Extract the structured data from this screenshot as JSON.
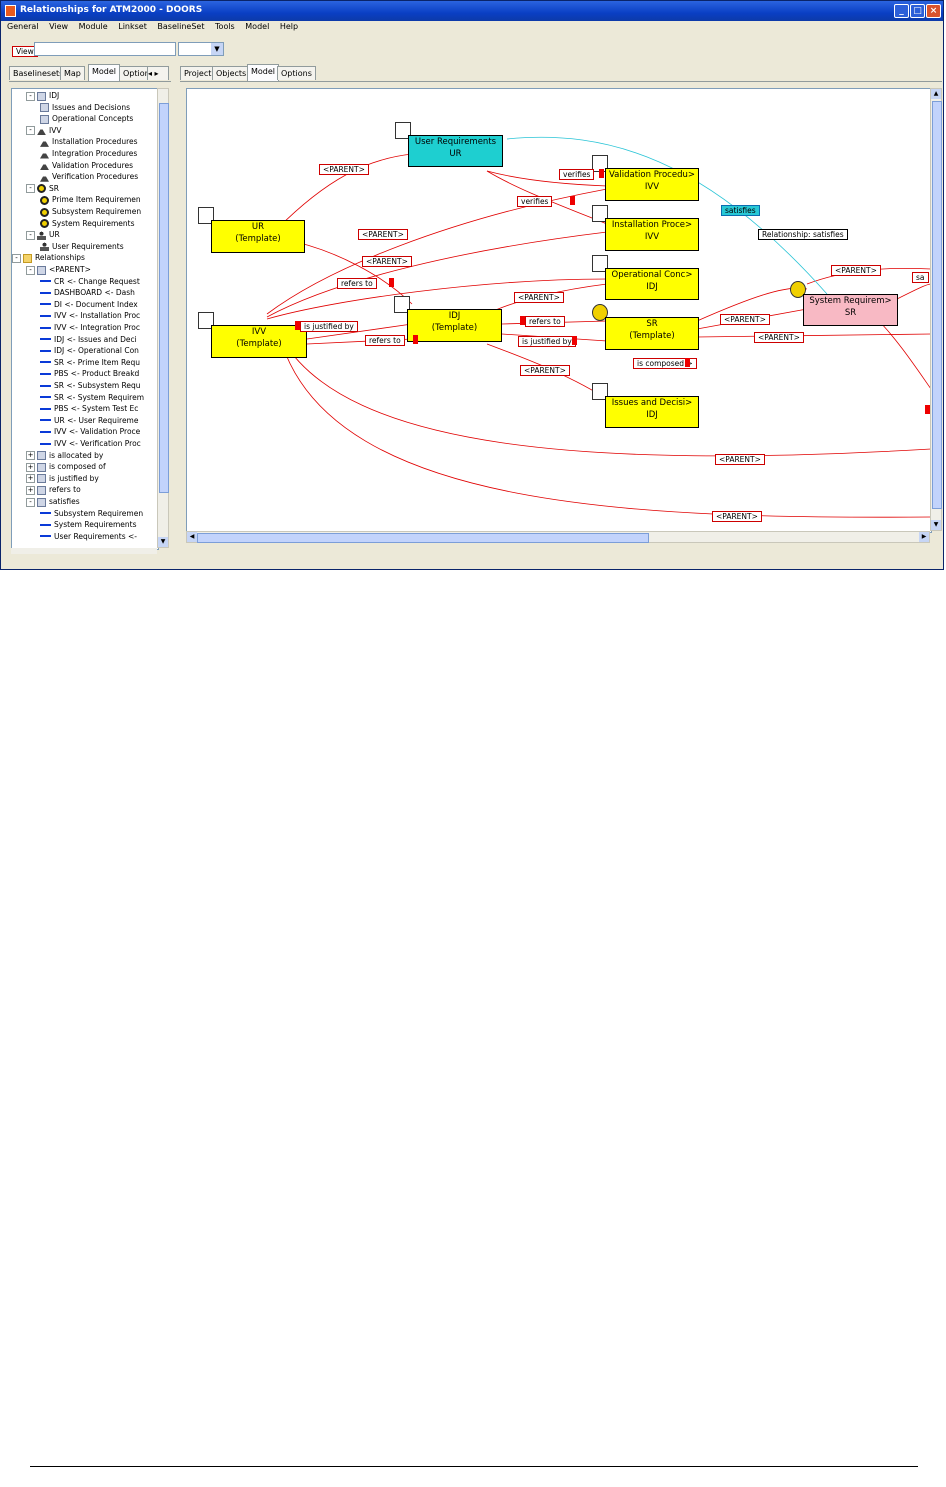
{
  "window": {
    "title": "Relationships for ATM2000 - DOORS"
  },
  "menu": [
    "General",
    "View",
    "Module",
    "Linkset",
    "BaselineSet",
    "Tools",
    "Model",
    "Help"
  ],
  "view_row": {
    "label": "View",
    "value": ""
  },
  "left_tabs": [
    "Baselinesets",
    "Map",
    "Model",
    "Option"
  ],
  "left_tab_selected": "Model",
  "tree": [
    {
      "indent": 0,
      "expander": "-",
      "icon": "mod",
      "label": "IDJ"
    },
    {
      "indent": 1,
      "icon": "mod",
      "label": "Issues and Decisions"
    },
    {
      "indent": 1,
      "icon": "mod",
      "label": "Operational Concepts"
    },
    {
      "indent": 0,
      "expander": "-",
      "icon": "flask",
      "label": "IVV"
    },
    {
      "indent": 1,
      "icon": "flask",
      "label": "Installation Procedures"
    },
    {
      "indent": 1,
      "icon": "flask",
      "label": "Integration Procedures"
    },
    {
      "indent": 1,
      "icon": "flask",
      "label": "Validation Procedures"
    },
    {
      "indent": 1,
      "icon": "flask",
      "label": "Verification Procedures"
    },
    {
      "indent": 0,
      "expander": "-",
      "icon": "gear",
      "label": "SR"
    },
    {
      "indent": 1,
      "icon": "gear",
      "label": "Prime Item Requiremen"
    },
    {
      "indent": 1,
      "icon": "gear",
      "label": "Subsystem Requiremen"
    },
    {
      "indent": 1,
      "icon": "gear",
      "label": "System Requirements"
    },
    {
      "indent": 0,
      "expander": "-",
      "icon": "person",
      "label": "UR"
    },
    {
      "indent": 1,
      "icon": "person",
      "label": "User Requirements"
    },
    {
      "indent": -1,
      "expander": "-",
      "icon": "folder",
      "label": "Relationships"
    },
    {
      "indent": 0,
      "expander": "-",
      "icon": "mod",
      "label": "<PARENT>"
    },
    {
      "indent": 1,
      "icon": "arrow",
      "label": "CR <- Change Request"
    },
    {
      "indent": 1,
      "icon": "arrow",
      "label": "DASHBOARD <- Dash"
    },
    {
      "indent": 1,
      "icon": "arrow",
      "label": "DI <- Document Index"
    },
    {
      "indent": 1,
      "icon": "arrow",
      "label": "IVV <- Installation Proc"
    },
    {
      "indent": 1,
      "icon": "arrow",
      "label": "IVV <- Integration Proc"
    },
    {
      "indent": 1,
      "icon": "arrow",
      "label": "IDJ <- Issues and Deci"
    },
    {
      "indent": 1,
      "icon": "arrow",
      "label": "IDJ <- Operational Con"
    },
    {
      "indent": 1,
      "icon": "arrow",
      "label": "SR <- Prime Item Requ"
    },
    {
      "indent": 1,
      "icon": "arrow",
      "label": "PBS <- Product Breakd"
    },
    {
      "indent": 1,
      "icon": "arrow",
      "label": "SR <- Subsystem Requ"
    },
    {
      "indent": 1,
      "icon": "arrow",
      "label": "SR <- System Requirem"
    },
    {
      "indent": 1,
      "icon": "arrow",
      "label": "PBS <- System Test Ec"
    },
    {
      "indent": 1,
      "icon": "arrow",
      "label": "UR <- User Requireme"
    },
    {
      "indent": 1,
      "icon": "arrow",
      "label": "IVV <- Validation Proce"
    },
    {
      "indent": 1,
      "icon": "arrow",
      "label": "IVV <- Verification Proc"
    },
    {
      "indent": 0,
      "expander": "+",
      "icon": "mod",
      "label": "is allocated by"
    },
    {
      "indent": 0,
      "expander": "+",
      "icon": "mod",
      "label": "is composed of"
    },
    {
      "indent": 0,
      "expander": "+",
      "icon": "mod",
      "label": "is justified by"
    },
    {
      "indent": 0,
      "expander": "+",
      "icon": "mod",
      "label": "refers to"
    },
    {
      "indent": 0,
      "expander": "-",
      "icon": "mod",
      "label": "satisfies"
    },
    {
      "indent": 1,
      "icon": "arrow",
      "label": "Subsystem Requiremen"
    },
    {
      "indent": 1,
      "icon": "arrow",
      "label": "System Requirements"
    },
    {
      "indent": 1,
      "icon": "arrow",
      "label": "User Requirements <-"
    }
  ],
  "right_tabs": [
    "Project",
    "Objects",
    "Model",
    "Options"
  ],
  "right_tab_selected": "Model",
  "nodes": [
    {
      "id": "ur_req",
      "line1": "User Requirements",
      "line2": "UR",
      "color": "cyan"
    },
    {
      "id": "val_proc",
      "line1": "Validation Procedu>",
      "line2": "IVV",
      "color": "yellow"
    },
    {
      "id": "inst_proc",
      "line1": "Installation Proce>",
      "line2": "IVV",
      "color": "yellow"
    },
    {
      "id": "ur_tmpl",
      "line1": "UR",
      "line2": "(Template)",
      "color": "yellow"
    },
    {
      "id": "op_conc",
      "line1": "Operational Conc>",
      "line2": "IDJ",
      "color": "yellow"
    },
    {
      "id": "sys_req",
      "line1": "System Requirem>",
      "line2": "SR",
      "color": "pink"
    },
    {
      "id": "ivv_tmpl",
      "line1": "IVV",
      "line2": "(Template)",
      "color": "yellow"
    },
    {
      "id": "idj_tmpl",
      "line1": "IDJ",
      "line2": "(Template)",
      "color": "yellow"
    },
    {
      "id": "sr_tmpl",
      "line1": "SR",
      "line2": "(Template)",
      "color": "yellow"
    },
    {
      "id": "issues",
      "line1": "Issues and Decisi>",
      "line2": "IDJ",
      "color": "yellow"
    }
  ],
  "edge_labels": {
    "parent": "<PARENT>",
    "verifies": "verifies",
    "satisfies": "satisfies",
    "refers_to": "refers to",
    "is_justified_by": "is justified by",
    "is_composed": "is composed >",
    "sa_cut": "sa"
  },
  "tooltip": "Relationship: satisfies",
  "colors": {
    "titlebar": "#0a3fc4",
    "node_yellow": "#ffff00",
    "node_cyan": "#1ecfd0",
    "node_pink": "#f8b9c4",
    "edge_red": "#e00000",
    "edge_cyan": "#29c4d6"
  }
}
